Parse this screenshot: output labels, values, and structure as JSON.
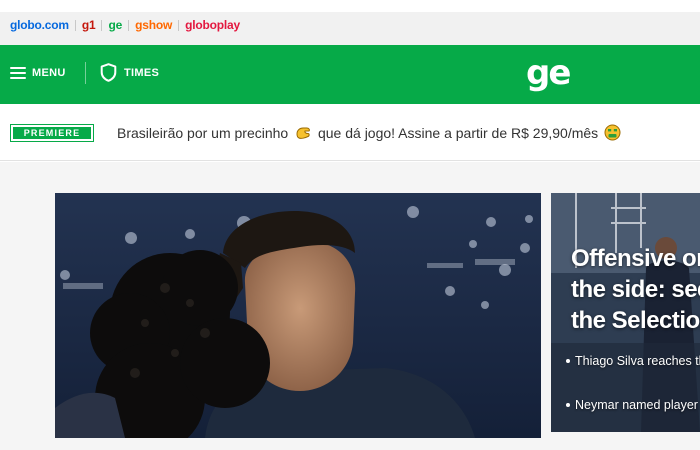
{
  "topbar": {
    "links": [
      {
        "label": "globo.com",
        "color": "#0669de"
      },
      {
        "label": "g1",
        "color": "#c4170c"
      },
      {
        "label": "ge",
        "color": "#06aa48"
      },
      {
        "label": "gshow",
        "color": "#ff6800"
      },
      {
        "label": "globoplay",
        "color": "#e3173f"
      }
    ]
  },
  "header": {
    "menu_label": "MENU",
    "times_label": "TIMES",
    "logo": "ge",
    "brand_color": "#06aa48"
  },
  "promo": {
    "badge": "PREMIERE",
    "text_part1": "Brasileirão por um precinho",
    "text_part2": "que dá jogo! Assine a partir de R$ 29,90/mês"
  },
  "side_story": {
    "title": "Offensive on the side: see the Selection",
    "items": [
      {
        "label": "Thiago Silva reaches the team"
      },
      {
        "label": "Neymar named player"
      }
    ]
  },
  "icons": {
    "menu": "hamburger-menu-icon",
    "times": "shield-icon",
    "promo_emoji_1": "pinching-hand-emoji",
    "promo_emoji_2": "money-mouth-face-emoji"
  }
}
